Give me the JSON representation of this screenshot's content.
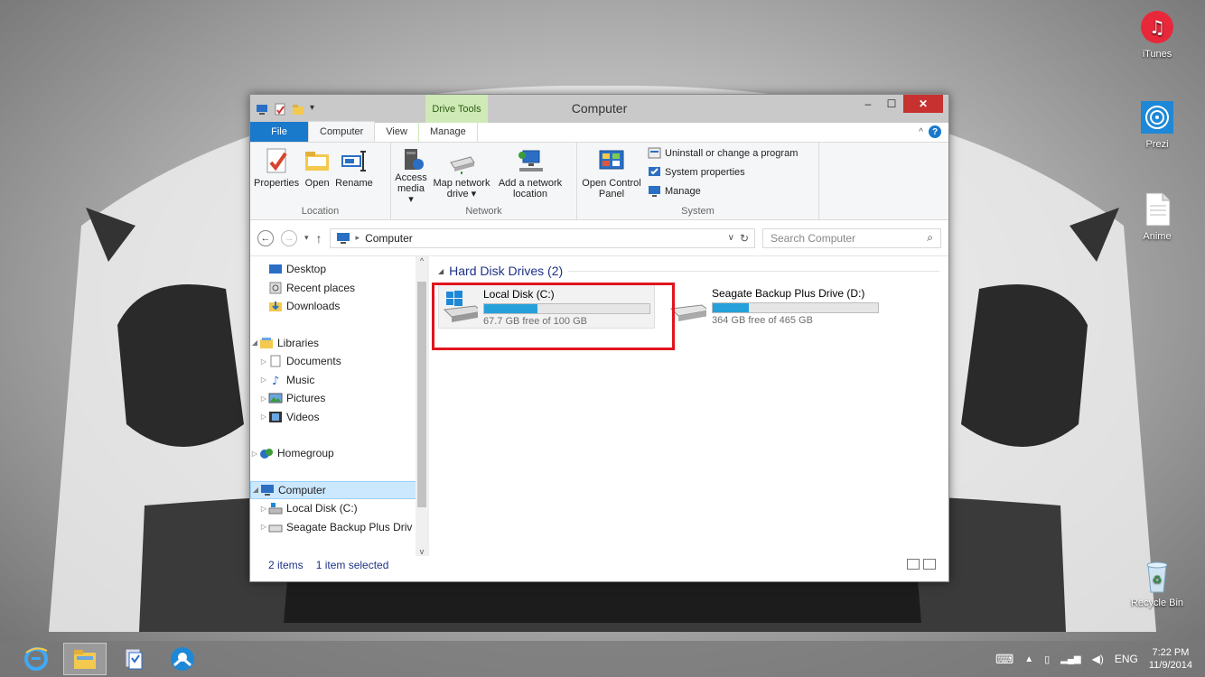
{
  "desktop": {
    "icons": [
      {
        "label": "iTunes",
        "icon": "itunes-icon"
      },
      {
        "label": "Prezi",
        "icon": "prezi-icon"
      },
      {
        "label": "Anime",
        "icon": "text-file-icon"
      },
      {
        "label": "Recycle Bin",
        "icon": "recycle-bin-icon"
      }
    ]
  },
  "window": {
    "title": "Computer",
    "context_tab_group": "Drive Tools",
    "tabs": [
      {
        "label": "File"
      },
      {
        "label": "Computer"
      },
      {
        "label": "View"
      },
      {
        "label": "Manage"
      }
    ],
    "ribbon": {
      "location": {
        "label": "Location",
        "buttons": [
          {
            "label": "Properties"
          },
          {
            "label": "Open"
          },
          {
            "label": "Rename"
          }
        ]
      },
      "network": {
        "label": "Network",
        "buttons": [
          {
            "label": "Access media ▾"
          },
          {
            "label": "Map network drive ▾"
          },
          {
            "label": "Add a network location"
          }
        ]
      },
      "system": {
        "label": "System",
        "open_control_panel": "Open Control Panel",
        "small_buttons": [
          {
            "label": "Uninstall or change a program"
          },
          {
            "label": "System properties"
          },
          {
            "label": "Manage"
          }
        ]
      }
    },
    "address": {
      "path": "Computer",
      "search_placeholder": "Search Computer"
    },
    "nav": {
      "desktop": "Desktop",
      "recent": "Recent places",
      "downloads": "Downloads",
      "libraries": "Libraries",
      "documents": "Documents",
      "music": "Music",
      "pictures": "Pictures",
      "videos": "Videos",
      "homegroup": "Homegroup",
      "computer": "Computer",
      "local_disk": "Local Disk (C:)",
      "seagate": "Seagate Backup Plus Driv"
    },
    "content": {
      "section": "Hard Disk Drives (2)",
      "drives": [
        {
          "name": "Local Disk (C:)",
          "free": "67.7 GB free of 100 GB",
          "used_fraction": 0.323
        },
        {
          "name": "Seagate Backup Plus Drive (D:)",
          "free": "364 GB free of 465 GB",
          "used_fraction": 0.217
        }
      ]
    },
    "status": {
      "items": "2 items",
      "selected": "1 item selected"
    }
  },
  "taskbar": {
    "pinned": [
      "internet-explorer-icon",
      "file-explorer-icon",
      "task-manager-icon",
      "app-icon"
    ],
    "language": "ENG",
    "time": "7:22 PM",
    "date": "11/9/2014"
  },
  "colors": {
    "accent": "#1979ca",
    "highlight_box": "#e0141e",
    "drive_bar": "#26a0da",
    "drive_tools": "#cfe9b7"
  }
}
